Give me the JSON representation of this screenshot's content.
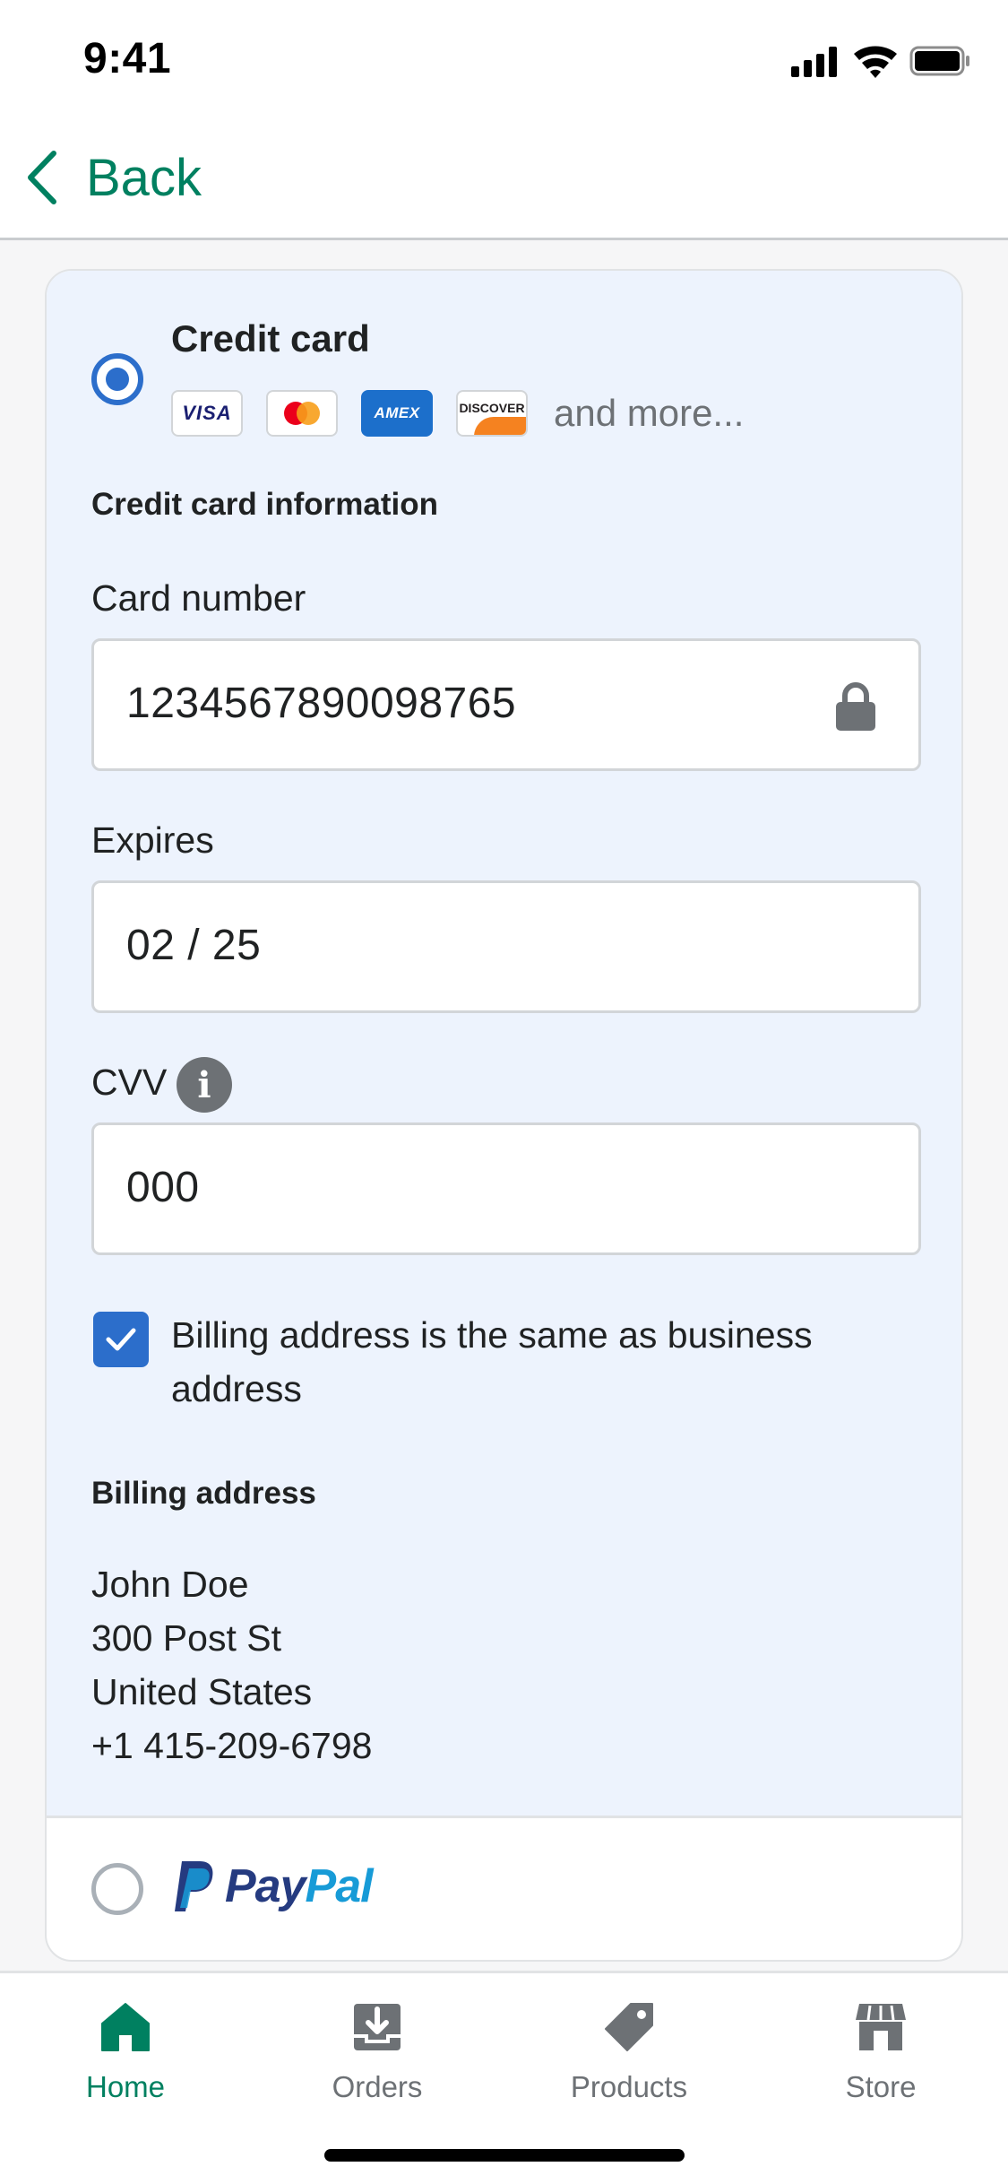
{
  "status_bar": {
    "time": "9:41"
  },
  "nav": {
    "back_label": "Back"
  },
  "credit_card": {
    "method_title": "Credit card",
    "logos": [
      "VISA",
      "mastercard",
      "AMEX",
      "DISCOVER"
    ],
    "and_more": "and more...",
    "section_heading": "Credit card information",
    "card_number_label": "Card number",
    "card_number_value": "1234567890098765",
    "expires_label": "Expires",
    "expires_value": "02 / 25",
    "cvv_label": "CVV",
    "cvv_value": "000",
    "billing_same_label": "Billing address is the same as business address",
    "billing_same_checked": true,
    "billing_heading": "Billing address",
    "billing_address": [
      "John Doe",
      "300 Post St",
      "United States",
      "+1 415-209-6798"
    ]
  },
  "paypal": {
    "pay": "Pay",
    "pal": "Pal",
    "selected": false
  },
  "tabs": [
    {
      "label": "Home",
      "icon": "home-icon",
      "active": true
    },
    {
      "label": "Orders",
      "icon": "orders-icon",
      "active": false
    },
    {
      "label": "Products",
      "icon": "tag-icon",
      "active": false
    },
    {
      "label": "Store",
      "icon": "store-icon",
      "active": false
    }
  ],
  "colors": {
    "accent_green": "#008060",
    "primary_blue": "#2c6ecb",
    "section_bg": "#edf3fd",
    "icon_gray": "#6d7175"
  }
}
